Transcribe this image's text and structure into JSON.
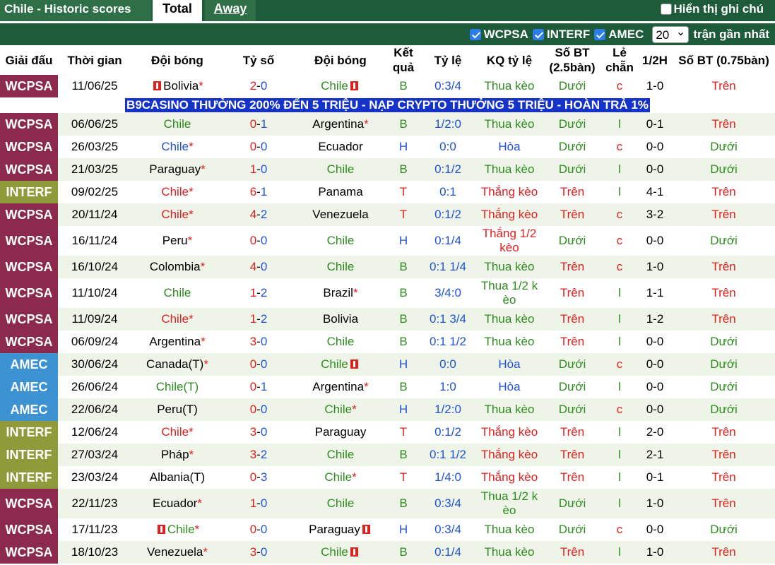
{
  "header": {
    "title": "Chile - Historic scores",
    "tabs": [
      "Total",
      "Away"
    ],
    "show_notes": "Hiển thị ghi chú"
  },
  "filters": {
    "items": [
      "WCPSA",
      "INTERF",
      "AMEC"
    ],
    "count": "20",
    "recent_label": "trận gần nhất"
  },
  "columns": [
    "Giải đấu",
    "Thời gian",
    "Đội bóng",
    "Tỷ số",
    "Đội bóng",
    "Kết quả",
    "Tỷ lệ",
    "KQ tỷ lệ",
    "Số BT (2.5bàn)",
    "Lẻ chẵn",
    "1/2H",
    "Số BT (0.75bàn)"
  ],
  "ad_text": "B9CASINO THƯỞNG 200% ĐẾN 5 TRIỆU - NẠP CRYPTO THƯỞNG 5 TRIỆU - HOÀN TRẢ 1%",
  "colors": {
    "WCPSA": "#8b2a4d",
    "INTERF": "#8f9a3a",
    "AMEC": "#3d93d1"
  },
  "rows": [
    {
      "league": "WCPSA",
      "date": "11/06/25",
      "home": "Bolivia*",
      "score": "2-0",
      "away": "Chile",
      "result": "B",
      "odds": "0:3/4",
      "odds_result": "Thua kèo",
      "ou": "Dưới",
      "oe": "c",
      "half": "1-0",
      "ou075": "Trên"
    },
    {
      "league": "WCPSA",
      "date": "06/06/25",
      "home": "Chile",
      "score": "0-1",
      "away": "Argentina*",
      "result": "B",
      "odds": "1/2:0",
      "odds_result": "Thua kèo",
      "ou": "Dưới",
      "oe": "l",
      "half": "0-1",
      "ou075": "Trên"
    },
    {
      "league": "WCPSA",
      "date": "26/03/25",
      "home": "Chile*",
      "score": "0-0",
      "away": "Ecuador",
      "result": "H",
      "odds": "0:0",
      "odds_result": "Hòa",
      "ou": "Dưới",
      "oe": "c",
      "half": "0-0",
      "ou075": "Dưới"
    },
    {
      "league": "WCPSA",
      "date": "21/03/25",
      "home": "Paraguay*",
      "score": "1-0",
      "away": "Chile",
      "result": "B",
      "odds": "0:1/2",
      "odds_result": "Thua kèo",
      "ou": "Dưới",
      "oe": "l",
      "half": "0-0",
      "ou075": "Dưới"
    },
    {
      "league": "INTERF",
      "date": "09/02/25",
      "home": "Chile*",
      "score": "6-1",
      "away": "Panama",
      "result": "T",
      "odds": "0:1",
      "odds_result": "Thắng kèo",
      "ou": "Trên",
      "oe": "l",
      "half": "4-1",
      "ou075": "Trên"
    },
    {
      "league": "WCPSA",
      "date": "20/11/24",
      "home": "Chile*",
      "score": "4-2",
      "away": "Venezuela",
      "result": "T",
      "odds": "0:1/2",
      "odds_result": "Thắng kèo",
      "ou": "Trên",
      "oe": "c",
      "half": "3-2",
      "ou075": "Trên"
    },
    {
      "league": "WCPSA",
      "date": "16/11/24",
      "home": "Peru*",
      "score": "0-0",
      "away": "Chile",
      "result": "H",
      "odds": "0:1/4",
      "odds_result": "Thắng 1/2 kèo",
      "ou": "Dưới",
      "oe": "c",
      "half": "0-0",
      "ou075": "Dưới"
    },
    {
      "league": "WCPSA",
      "date": "16/10/24",
      "home": "Colombia*",
      "score": "4-0",
      "away": "Chile",
      "result": "B",
      "odds": "0:1 1/4",
      "odds_result": "Thua kèo",
      "ou": "Trên",
      "oe": "c",
      "half": "1-0",
      "ou075": "Trên"
    },
    {
      "league": "WCPSA",
      "date": "11/10/24",
      "home": "Chile",
      "score": "1-2",
      "away": "Brazil*",
      "result": "B",
      "odds": "3/4:0",
      "odds_result": "Thua 1/2 k èo",
      "ou": "Trên",
      "oe": "l",
      "half": "1-1",
      "ou075": "Trên"
    },
    {
      "league": "WCPSA",
      "date": "11/09/24",
      "home": "Chile*",
      "score": "1-2",
      "away": "Bolivia",
      "result": "B",
      "odds": "0:1 3/4",
      "odds_result": "Thua kèo",
      "ou": "Trên",
      "oe": "l",
      "half": "1-2",
      "ou075": "Trên"
    },
    {
      "league": "WCPSA",
      "date": "06/09/24",
      "home": "Argentina*",
      "score": "3-0",
      "away": "Chile",
      "result": "B",
      "odds": "0:1 1/2",
      "odds_result": "Thua kèo",
      "ou": "Trên",
      "oe": "l",
      "half": "0-0",
      "ou075": "Dưới"
    },
    {
      "league": "AMEC",
      "date": "30/06/24",
      "home": "Canada(T)*",
      "score": "0-0",
      "away": "Chile",
      "result": "H",
      "odds": "0:0",
      "odds_result": "Hòa",
      "ou": "Dưới",
      "oe": "c",
      "half": "0-0",
      "ou075": "Dưới"
    },
    {
      "league": "AMEC",
      "date": "26/06/24",
      "home": "Chile(T)",
      "score": "0-1",
      "away": "Argentina*",
      "result": "B",
      "odds": "1:0",
      "odds_result": "Hòa",
      "ou": "Dưới",
      "oe": "l",
      "half": "0-0",
      "ou075": "Dưới"
    },
    {
      "league": "AMEC",
      "date": "22/06/24",
      "home": "Peru(T)",
      "score": "0-0",
      "away": "Chile*",
      "result": "H",
      "odds": "1/2:0",
      "odds_result": "Thua kèo",
      "ou": "Dưới",
      "oe": "c",
      "half": "0-0",
      "ou075": "Dưới"
    },
    {
      "league": "INTERF",
      "date": "12/06/24",
      "home": "Chile*",
      "score": "3-0",
      "away": "Paraguay",
      "result": "T",
      "odds": "0:1/2",
      "odds_result": "Thắng kèo",
      "ou": "Trên",
      "oe": "l",
      "half": "2-0",
      "ou075": "Trên"
    },
    {
      "league": "INTERF",
      "date": "27/03/24",
      "home": "Pháp*",
      "score": "3-2",
      "away": "Chile",
      "result": "B",
      "odds": "0:1 1/2",
      "odds_result": "Thắng kèo",
      "ou": "Trên",
      "oe": "l",
      "half": "2-1",
      "ou075": "Trên"
    },
    {
      "league": "INTERF",
      "date": "23/03/24",
      "home": "Albania(T)",
      "score": "0-3",
      "away": "Chile*",
      "result": "T",
      "odds": "1/4:0",
      "odds_result": "Thắng kèo",
      "ou": "Trên",
      "oe": "l",
      "half": "0-1",
      "ou075": "Trên"
    },
    {
      "league": "WCPSA",
      "date": "22/11/23",
      "home": "Ecuador*",
      "score": "1-0",
      "away": "Chile",
      "result": "B",
      "odds": "0:3/4",
      "odds_result": "Thua 1/2 k èo",
      "ou": "Dưới",
      "oe": "l",
      "half": "1-0",
      "ou075": "Trên"
    },
    {
      "league": "WCPSA",
      "date": "17/11/23",
      "home": "Chile*",
      "score": "0-0",
      "away": "Paraguay",
      "result": "H",
      "odds": "0:3/4",
      "odds_result": "Thua kèo",
      "ou": "Dưới",
      "oe": "c",
      "half": "0-0",
      "ou075": "Dưới"
    },
    {
      "league": "WCPSA",
      "date": "18/10/23",
      "home": "Venezuela*",
      "score": "3-0",
      "away": "Chile",
      "result": "B",
      "odds": "0:1/4",
      "odds_result": "Thua kèo",
      "ou": "Trên",
      "oe": "l",
      "half": "1-0",
      "ou075": "Trên"
    }
  ]
}
